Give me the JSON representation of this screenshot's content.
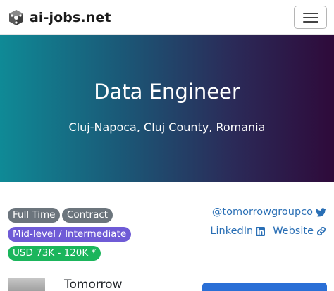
{
  "navbar": {
    "brand": "ai-jobs.net",
    "brand_icon": "ai-jobs-logo-icon",
    "menu_icon": "hamburger-menu-icon"
  },
  "hero": {
    "title": "Data Engineer",
    "location": "Cluj-Napoca, Cluj County, Romania",
    "gradient_start": "#0f8a96",
    "gradient_end": "#2e0a3a"
  },
  "badges": {
    "full_time": "Full Time",
    "contract": "Contract",
    "level": "Mid-level / Intermediate",
    "salary": "USD 73K - 120K *"
  },
  "social": {
    "twitter": "@tomorrowgroupco",
    "twitter_icon": "twitter-icon",
    "linkedin": "LinkedIn",
    "linkedin_icon": "linkedin-icon",
    "website": "Website",
    "website_icon": "link-icon"
  },
  "company": {
    "name": "Tomorrow"
  },
  "colors": {
    "badge_gray": "#6c757d",
    "badge_purple": "#6f5bd6",
    "badge_green": "#1bb55c",
    "link": "#2a6fb5",
    "apply_button": "#2a6fd6"
  }
}
